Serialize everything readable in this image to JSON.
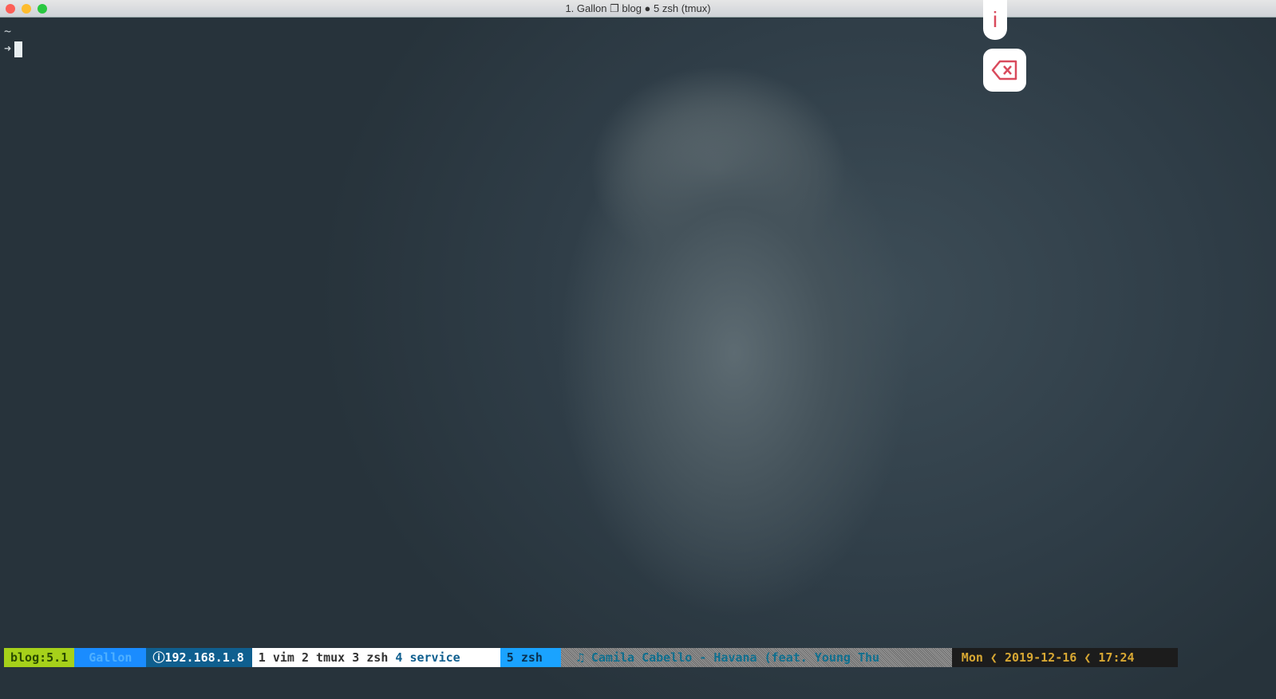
{
  "window": {
    "title": "1. Gallon ❐ blog ● 5 zsh (tmux)"
  },
  "terminal": {
    "cwd": "~",
    "prompt_symbol": "➜"
  },
  "floating": {
    "info_label": "i",
    "delete_icon": "backspace-x-icon"
  },
  "status": {
    "session": "blog:5.1",
    "user": "Gallon",
    "ip": "192.168.1.8",
    "ip_icon": "ⓘ",
    "windows": [
      {
        "label": "1 vim"
      },
      {
        "label": "2 tmux"
      },
      {
        "label": "3 zsh"
      },
      {
        "label": "4 service"
      }
    ],
    "active_window": "5 zsh",
    "now_playing": "♫ Camila Cabello - Havana (feat. Young Thu",
    "day": "Mon",
    "date": "2019-12-16",
    "time": "17:24",
    "colors": {
      "session": "#a6d11a",
      "user": "#1a8cff",
      "ip": "#0f5f8f",
      "windows": "#ffffff",
      "active": "#1aa3ff",
      "music": "#8a8a8a",
      "clock": "#1c1c1c",
      "clock_text": "#d7a733"
    }
  }
}
